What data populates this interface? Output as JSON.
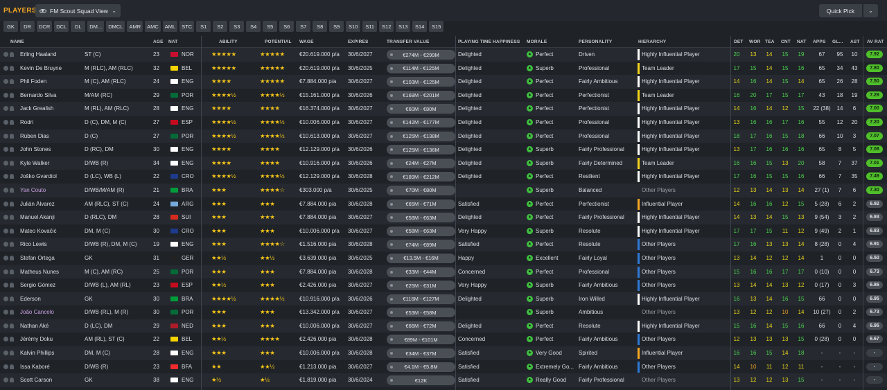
{
  "header": {
    "title": "PLAYERS",
    "view_label": "FM Scout Squad View",
    "quick_pick": "Quick Pick"
  },
  "filters": [
    "GK",
    "DR",
    "DCR",
    "DCL",
    "DL",
    "DM...",
    "DMCL",
    "AMR",
    "AMC",
    "AML",
    "STC",
    "S1",
    "S2",
    "S3",
    "S4",
    "S5",
    "S6",
    "S7",
    "S8",
    "S9",
    "S10",
    "S11",
    "S12",
    "S13",
    "S14",
    "S15"
  ],
  "columns": {
    "name": "NAME",
    "age": "AGE",
    "nat": "NAT",
    "ability": "ABILITY",
    "potential": "POTENTIAL",
    "wage": "WAGE",
    "expires": "EXPIRES",
    "transfer": "TRANSFER VALUE",
    "playing_time": "PLAYING TIME HAPPINESS",
    "morale": "MORALE",
    "personality": "PERSONALITY",
    "hierarchy": "HIERARCHY",
    "det": "DET",
    "wor": "WOR",
    "tea": "TEA",
    "cnt": "CNT",
    "nat2": "NAT",
    "apps": "APPS",
    "gls": "GL...",
    "ast": "AST",
    "avrat": "AV RAT"
  },
  "colors": {
    "accent": "#f5a623",
    "star": "#f5c518",
    "green": "#3fbf3f",
    "yellow": "#f2d21b"
  },
  "players": [
    {
      "name": "Erling Haaland",
      "pos": "ST (C)",
      "age": "23",
      "flag": "NOR",
      "ability": "★★★★★",
      "potential": "★★★★★",
      "wage": "€20.619.000 p/a",
      "expires": "30/6/2027",
      "tv": "€274M - €299M",
      "pt": "Delighted",
      "morale": "Perfect",
      "personality": "Driven",
      "hierarchy": "Highly Influential Player",
      "hbar": "#ffffff",
      "det": "20",
      "wor": "13",
      "tea": "14",
      "cnt": "15",
      "nat": "19",
      "apps": "67",
      "gls": "95",
      "ast": "10",
      "avrat": "7.92"
    },
    {
      "name": "Kevin De Bruyne",
      "pos": "M (RLC), AM (RLC)",
      "age": "32",
      "flag": "BEL",
      "ability": "★★★★★",
      "potential": "★★★★★",
      "wage": "€20.619.000 p/a",
      "expires": "30/6/2025",
      "tv": "€114M - €125M",
      "pt": "Delighted",
      "morale": "Superb",
      "personality": "Professional",
      "hierarchy": "Team Leader",
      "hbar": "#f2d21b",
      "det": "17",
      "wor": "15",
      "tea": "14",
      "cnt": "15",
      "nat": "16",
      "apps": "65",
      "gls": "34",
      "ast": "43",
      "avrat": "7.80"
    },
    {
      "name": "Phil Foden",
      "pos": "M (C), AM (RLC)",
      "age": "24",
      "flag": "ENG",
      "ability": "★★★★",
      "potential": "★★★★★",
      "wage": "€7.884.000 p/a",
      "expires": "30/6/2027",
      "tv": "€103M - €125M",
      "pt": "Delighted",
      "morale": "Perfect",
      "personality": "Fairly Ambitious",
      "hierarchy": "Highly Influential Player",
      "hbar": "#ffffff",
      "det": "14",
      "wor": "16",
      "tea": "14",
      "cnt": "15",
      "nat": "14",
      "apps": "65",
      "gls": "26",
      "ast": "28",
      "avrat": "7.50"
    },
    {
      "name": "Bernardo Silva",
      "pos": "M/AM (RC)",
      "age": "29",
      "flag": "POR",
      "ability": "★★★★½",
      "potential": "★★★★½",
      "wage": "€15.161.000 p/a",
      "expires": "30/6/2026",
      "tv": "€168M - €201M",
      "pt": "Delighted",
      "morale": "Perfect",
      "personality": "Perfectionist",
      "hierarchy": "Team Leader",
      "hbar": "#f2d21b",
      "det": "16",
      "wor": "20",
      "tea": "17",
      "cnt": "15",
      "nat": "17",
      "apps": "43",
      "gls": "18",
      "ast": "19",
      "avrat": "7.29"
    },
    {
      "name": "Jack Grealish",
      "pos": "M (RL), AM (RLC)",
      "age": "28",
      "flag": "ENG",
      "ability": "★★★★",
      "potential": "★★★★",
      "wage": "€16.374.000 p/a",
      "expires": "30/6/2027",
      "tv": "€60M - €80M",
      "pt": "Delighted",
      "morale": "Perfect",
      "personality": "Perfectionist",
      "hierarchy": "Highly Influential Player",
      "hbar": "#ffffff",
      "det": "14",
      "wor": "16",
      "tea": "14",
      "cnt": "12",
      "nat": "15",
      "apps": "22 (38)",
      "gls": "14",
      "ast": "6",
      "avrat": "7.00"
    },
    {
      "name": "Rodri",
      "pos": "D (C), DM, M (C)",
      "age": "27",
      "flag": "ESP",
      "ability": "★★★★½",
      "potential": "★★★★½",
      "wage": "€10.006.000 p/a",
      "expires": "30/6/2027",
      "tv": "€142M - €177M",
      "pt": "Delighted",
      "morale": "Perfect",
      "personality": "Professional",
      "hierarchy": "Highly Influential Player",
      "hbar": "#ffffff",
      "det": "13",
      "wor": "16",
      "tea": "16",
      "cnt": "17",
      "nat": "16",
      "apps": "55",
      "gls": "12",
      "ast": "20",
      "avrat": "7.20"
    },
    {
      "name": "Rúben Dias",
      "pos": "D (C)",
      "age": "27",
      "flag": "POR",
      "ability": "★★★★½",
      "potential": "★★★★½",
      "wage": "€10.613.000 p/a",
      "expires": "30/6/2027",
      "tv": "€125M - €138M",
      "pt": "Delighted",
      "morale": "Perfect",
      "personality": "Professional",
      "hierarchy": "Highly Influential Player",
      "hbar": "#ffffff",
      "det": "18",
      "wor": "17",
      "tea": "16",
      "cnt": "15",
      "nat": "18",
      "apps": "66",
      "gls": "10",
      "ast": "3",
      "avrat": "7.07"
    },
    {
      "name": "John Stones",
      "pos": "D (RC), DM",
      "age": "30",
      "flag": "ENG",
      "ability": "★★★★",
      "potential": "★★★★",
      "wage": "€12.129.000 p/a",
      "expires": "30/6/2026",
      "tv": "€125M - €136M",
      "pt": "Delighted",
      "morale": "Superb",
      "personality": "Fairly Professional",
      "hierarchy": "Highly Influential Player",
      "hbar": "#ffffff",
      "det": "13",
      "wor": "17",
      "tea": "16",
      "cnt": "16",
      "nat": "16",
      "apps": "65",
      "gls": "8",
      "ast": "5",
      "avrat": "7.08"
    },
    {
      "name": "Kyle Walker",
      "pos": "D/WB (R)",
      "age": "34",
      "flag": "ENG",
      "ability": "★★★★",
      "potential": "★★★★",
      "wage": "€10.916.000 p/a",
      "expires": "30/6/2026",
      "tv": "€24M - €27M",
      "pt": "Delighted",
      "morale": "Superb",
      "personality": "Fairly Determined",
      "hierarchy": "Team Leader",
      "hbar": "#f2d21b",
      "det": "16",
      "wor": "16",
      "tea": "15",
      "cnt": "13",
      "nat": "20",
      "apps": "58",
      "gls": "7",
      "ast": "37",
      "avrat": "7.01"
    },
    {
      "name": "Joško Gvardiol",
      "pos": "D (LC), WB (L)",
      "age": "22",
      "flag": "CRO",
      "ability": "★★★★½",
      "potential": "★★★★½",
      "wage": "€12.129.000 p/a",
      "expires": "30/6/2028",
      "tv": "€189M - €212M",
      "pt": "Delighted",
      "morale": "Perfect",
      "personality": "Resilient",
      "hierarchy": "Highly Influential Player",
      "hbar": "#ffffff",
      "det": "17",
      "wor": "16",
      "tea": "15",
      "cnt": "15",
      "nat": "16",
      "apps": "66",
      "gls": "7",
      "ast": "35",
      "avrat": "7.49"
    },
    {
      "name": "Yan Couto",
      "pos": "D/WB/M/AM (R)",
      "age": "21",
      "flag": "BRA",
      "ability": "★★★",
      "potential": "★★★★☆",
      "wage": "€303.000 p/a",
      "expires": "30/6/2025",
      "tv": "€70M - €80M",
      "pt": "",
      "morale": "Superb",
      "personality": "Balanced",
      "hierarchy": "Other Players",
      "hbar": "",
      "det": "12",
      "wor": "13",
      "tea": "14",
      "cnt": "13",
      "nat": "14",
      "apps": "27 (1)",
      "gls": "7",
      "ast": "6",
      "avrat": "7.30",
      "loan": true
    },
    {
      "name": "Julián Álvarez",
      "pos": "AM (RLC), ST (C)",
      "age": "24",
      "flag": "ARG",
      "ability": "★★★",
      "potential": "★★★",
      "wage": "€7.884.000 p/a",
      "expires": "30/6/2028",
      "tv": "€65M - €71M",
      "pt": "Satisfied",
      "morale": "Perfect",
      "personality": "Perfectionist",
      "hierarchy": "Influential Player",
      "hbar": "#f5a623",
      "det": "14",
      "wor": "16",
      "tea": "16",
      "cnt": "12",
      "nat": "15",
      "apps": "5 (28)",
      "gls": "6",
      "ast": "2",
      "avrat": "6.92"
    },
    {
      "name": "Manuel Akanji",
      "pos": "D (RLC), DM",
      "age": "28",
      "flag": "SUI",
      "ability": "★★★",
      "potential": "★★★",
      "wage": "€7.884.000 p/a",
      "expires": "30/6/2027",
      "tv": "€58M - €63M",
      "pt": "Delighted",
      "morale": "Perfect",
      "personality": "Fairly Professional",
      "hierarchy": "Highly Influential Player",
      "hbar": "#ffffff",
      "det": "14",
      "wor": "13",
      "tea": "14",
      "cnt": "15",
      "nat": "13",
      "apps": "9 (54)",
      "gls": "3",
      "ast": "2",
      "avrat": "6.93"
    },
    {
      "name": "Mateo Kovačić",
      "pos": "DM, M (C)",
      "age": "30",
      "flag": "CRO",
      "ability": "★★★",
      "potential": "★★★",
      "wage": "€10.006.000 p/a",
      "expires": "30/6/2027",
      "tv": "€58M - €63M",
      "pt": "Very Happy",
      "morale": "Superb",
      "personality": "Resolute",
      "hierarchy": "Highly Influential Player",
      "hbar": "#ffffff",
      "det": "17",
      "wor": "17",
      "tea": "15",
      "cnt": "11",
      "nat": "12",
      "apps": "9 (49)",
      "gls": "2",
      "ast": "1",
      "avrat": "6.83"
    },
    {
      "name": "Rico Lewis",
      "pos": "D/WB (R), DM, M (C)",
      "age": "19",
      "flag": "ENG",
      "ability": "★★★",
      "potential": "★★★★☆",
      "wage": "€1.516.000 p/a",
      "expires": "30/6/2028",
      "tv": "€74M - €89M",
      "pt": "Satisfied",
      "morale": "Perfect",
      "personality": "Resolute",
      "hierarchy": "Other Players",
      "hbar": "#2f7ad6",
      "det": "17",
      "wor": "16",
      "tea": "13",
      "cnt": "13",
      "nat": "14",
      "apps": "8 (28)",
      "gls": "0",
      "ast": "4",
      "avrat": "6.91"
    },
    {
      "name": "Stefan Ortega",
      "pos": "GK",
      "age": "31",
      "flag": "GER",
      "ability": "★★½",
      "potential": "★★½",
      "wage": "€3.639.000 p/a",
      "expires": "30/6/2025",
      "tv": "€13.5M - €16M",
      "pt": "Happy",
      "morale": "Excellent",
      "personality": "Fairly Loyal",
      "hierarchy": "Other Players",
      "hbar": "#2f7ad6",
      "det": "13",
      "wor": "14",
      "tea": "12",
      "cnt": "12",
      "nat": "14",
      "apps": "1",
      "gls": "0",
      "ast": "0",
      "avrat": "6.50"
    },
    {
      "name": "Matheus Nunes",
      "pos": "M (C), AM (RC)",
      "age": "25",
      "flag": "POR",
      "ability": "★★★",
      "potential": "★★★",
      "wage": "€7.884.000 p/a",
      "expires": "30/6/2028",
      "tv": "€33M - €44M",
      "pt": "Concerned",
      "morale": "Perfect",
      "personality": "Professional",
      "hierarchy": "Other Players",
      "hbar": "#2f7ad6",
      "det": "15",
      "wor": "16",
      "tea": "16",
      "cnt": "17",
      "nat": "17",
      "apps": "0 (10)",
      "gls": "0",
      "ast": "0",
      "avrat": "6.73"
    },
    {
      "name": "Sergio Gómez",
      "pos": "D/WB (L), AM (RL)",
      "age": "23",
      "flag": "ESP",
      "ability": "★★½",
      "potential": "★★★",
      "wage": "€2.426.000 p/a",
      "expires": "30/6/2027",
      "tv": "€25M - €31M",
      "pt": "Very Happy",
      "morale": "Superb",
      "personality": "Fairly Ambitious",
      "hierarchy": "Other Players",
      "hbar": "#2f7ad6",
      "det": "13",
      "wor": "14",
      "tea": "14",
      "cnt": "13",
      "nat": "12",
      "apps": "0 (17)",
      "gls": "0",
      "ast": "3",
      "avrat": "6.86"
    },
    {
      "name": "Ederson",
      "pos": "GK",
      "age": "30",
      "flag": "BRA",
      "ability": "★★★★½",
      "potential": "★★★★½",
      "wage": "€10.916.000 p/a",
      "expires": "30/6/2026",
      "tv": "€116M - €127M",
      "pt": "Delighted",
      "morale": "Superb",
      "personality": "Iron Willed",
      "hierarchy": "Highly Influential Player",
      "hbar": "#ffffff",
      "det": "16",
      "wor": "13",
      "tea": "14",
      "cnt": "16",
      "nat": "15",
      "apps": "66",
      "gls": "0",
      "ast": "0",
      "avrat": "6.95"
    },
    {
      "name": "João Cancelo",
      "pos": "D/WB (RL), M (R)",
      "age": "30",
      "flag": "POR",
      "ability": "★★★",
      "potential": "★★★",
      "wage": "€13.342.000 p/a",
      "expires": "30/6/2027",
      "tv": "€53M - €58M",
      "pt": "",
      "morale": "Superb",
      "personality": "Ambitious",
      "hierarchy": "Other Players",
      "hbar": "",
      "det": "13",
      "wor": "12",
      "tea": "12",
      "cnt": "10",
      "nat": "14",
      "apps": "10 (27)",
      "gls": "0",
      "ast": "2",
      "avrat": "6.73",
      "loan": true
    },
    {
      "name": "Nathan Aké",
      "pos": "D (LC), DM",
      "age": "29",
      "flag": "NED",
      "ability": "★★★",
      "potential": "★★★",
      "wage": "€10.006.000 p/a",
      "expires": "30/6/2027",
      "tv": "€66M - €72M",
      "pt": "Delighted",
      "morale": "Perfect",
      "personality": "Resolute",
      "hierarchy": "Highly Influential Player",
      "hbar": "#ffffff",
      "det": "15",
      "wor": "16",
      "tea": "14",
      "cnt": "15",
      "nat": "16",
      "apps": "66",
      "gls": "0",
      "ast": "4",
      "avrat": "6.95"
    },
    {
      "name": "Jérémy Doku",
      "pos": "AM (RL), ST (C)",
      "age": "22",
      "flag": "BEL",
      "ability": "★★½",
      "potential": "★★★★",
      "wage": "€2.426.000 p/a",
      "expires": "30/6/2028",
      "tv": "€89M - €101M",
      "pt": "Concerned",
      "morale": "Perfect",
      "personality": "Fairly Ambitious",
      "hierarchy": "Other Players",
      "hbar": "#2f7ad6",
      "det": "12",
      "wor": "13",
      "tea": "13",
      "cnt": "13",
      "nat": "15",
      "apps": "0 (28)",
      "gls": "0",
      "ast": "0",
      "avrat": "6.67"
    },
    {
      "name": "Kalvin Phillips",
      "pos": "DM, M (C)",
      "age": "28",
      "flag": "ENG",
      "ability": "★★★",
      "potential": "★★★",
      "wage": "€10.006.000 p/a",
      "expires": "30/6/2028",
      "tv": "€34M - €37M",
      "pt": "Satisfied",
      "morale": "Very Good",
      "personality": "Spirited",
      "hierarchy": "Influential Player",
      "hbar": "#f5a623",
      "det": "16",
      "wor": "16",
      "tea": "15",
      "cnt": "14",
      "nat": "18",
      "apps": "-",
      "gls": "-",
      "ast": "-",
      "avrat": "-"
    },
    {
      "name": "Issa Kaboré",
      "pos": "D/WB (R)",
      "age": "23",
      "flag": "BFA",
      "ability": "★★",
      "potential": "★★½",
      "wage": "€1.213.000 p/a",
      "expires": "30/6/2027",
      "tv": "€4.1M - €5.8M",
      "pt": "Satisfied",
      "morale": "Extremely Go...",
      "personality": "Fairly Ambitious",
      "hierarchy": "Other Players",
      "hbar": "#2f7ad6",
      "det": "14",
      "wor": "10",
      "tea": "11",
      "cnt": "12",
      "nat": "11",
      "apps": "-",
      "gls": "-",
      "ast": "-",
      "avrat": "-"
    },
    {
      "name": "Scott Carson",
      "pos": "GK",
      "age": "38",
      "flag": "ENG",
      "ability": "★½",
      "potential": "★½",
      "wage": "€1.819.000 p/a",
      "expires": "30/6/2024",
      "tv": "€12K",
      "pt": "Satisfied",
      "morale": "Really Good",
      "personality": "Fairly Professional",
      "hierarchy": "Other Players",
      "hbar": "",
      "det": "13",
      "wor": "12",
      "tea": "12",
      "cnt": "13",
      "nat": "15",
      "apps": "-",
      "gls": "-",
      "ast": "-",
      "avrat": "-"
    }
  ]
}
